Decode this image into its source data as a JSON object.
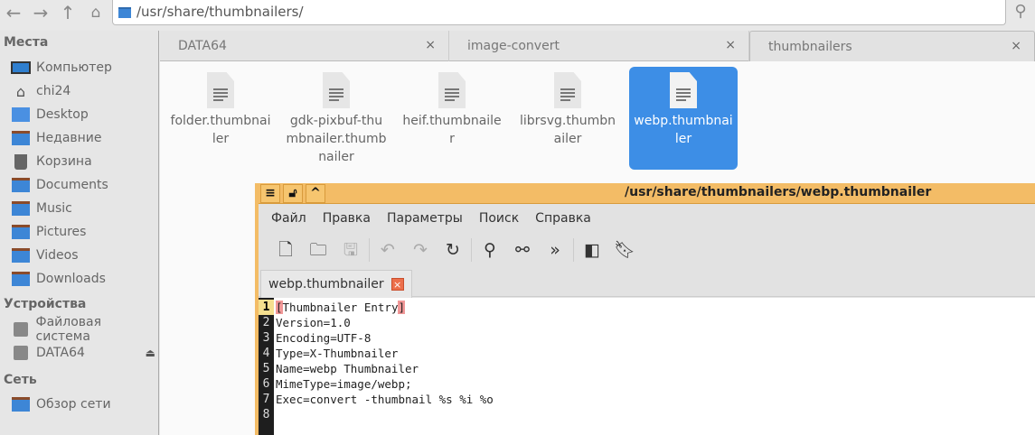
{
  "location": {
    "path": "/usr/share/thumbnailers/"
  },
  "sidebar": {
    "places_header": "Места",
    "places": [
      {
        "label": "Компьютер",
        "icon": "computer-icon"
      },
      {
        "label": "chi24",
        "icon": "home-icon"
      },
      {
        "label": "Desktop",
        "icon": "desktop-icon"
      },
      {
        "label": "Недавние",
        "icon": "recent-folder-icon"
      },
      {
        "label": "Корзина",
        "icon": "trash-icon"
      },
      {
        "label": "Documents",
        "icon": "folder-icon"
      },
      {
        "label": "Music",
        "icon": "music-folder-icon"
      },
      {
        "label": "Pictures",
        "icon": "pictures-folder-icon"
      },
      {
        "label": "Videos",
        "icon": "videos-folder-icon"
      },
      {
        "label": "Downloads",
        "icon": "downloads-folder-icon"
      }
    ],
    "devices_header": "Устройства",
    "devices": [
      {
        "label": "Файловая система",
        "icon": "drive-icon"
      },
      {
        "label": "DATA64",
        "icon": "removable-drive-icon"
      }
    ],
    "network_header": "Сеть",
    "network": [
      {
        "label": "Обзор сети",
        "icon": "network-folder-icon"
      }
    ]
  },
  "tabs": [
    {
      "label": "DATA64",
      "close": "×"
    },
    {
      "label": "image-convert",
      "close": "×"
    },
    {
      "label": "thumbnailers",
      "close": "×",
      "active": true
    }
  ],
  "files": [
    {
      "name": "folder.thumbnailer"
    },
    {
      "name": "gdk-pixbuf-thumbnailer.thumbnailer"
    },
    {
      "name": "heif.thumbnailer"
    },
    {
      "name": "librsvg.thumbnailer"
    },
    {
      "name": "webp.thumbnailer",
      "selected": true
    }
  ],
  "editor": {
    "title": "/usr/share/thumbnailers/webp.thumbnailer",
    "menu": [
      "Файл",
      "Правка",
      "Параметры",
      "Поиск",
      "Справка"
    ],
    "tab_label": "webp.thumbnailer",
    "tab_close": "×",
    "lines": [
      "[Thumbnailer Entry]",
      "Version=1.0",
      "Encoding=UTF-8",
      "Type=X-Thumbnailer",
      "Name=webp Thumbnailer",
      "MimeType=image/webp;",
      "Exec=convert -thumbnail %s %i %o",
      ""
    ],
    "line_numbers": [
      "1",
      "2",
      "3",
      "4",
      "5",
      "6",
      "7",
      "8"
    ],
    "current_line": 1
  },
  "colors": {
    "accent": "#3d8ee6",
    "editor_title": "#f3bc66",
    "bracket_match": "#f19898"
  }
}
